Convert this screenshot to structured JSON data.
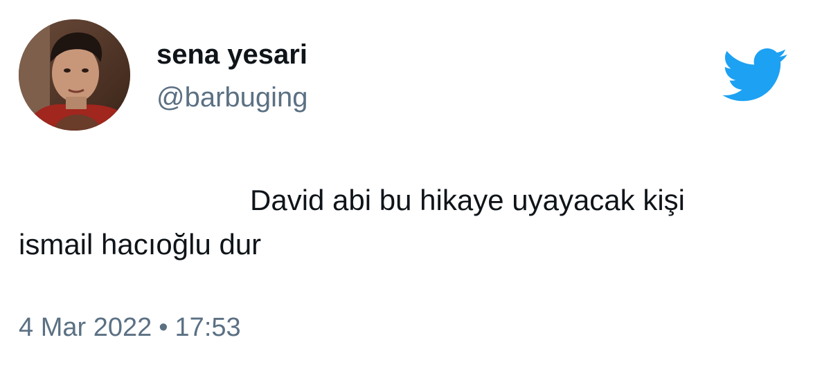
{
  "tweet": {
    "author": {
      "display_name": "sena yesari",
      "handle": "@barbuging",
      "avatar_icon": "profile-photo"
    },
    "brand": {
      "icon": "twitter-bird-icon",
      "color": "#1da1f2"
    },
    "text_line1": "David abi bu hikaye uyayacak kişi",
    "text_line2": "ismail hacıoğlu dur",
    "date": "4 Mar 2022",
    "separator": "•",
    "time": "17:53"
  }
}
